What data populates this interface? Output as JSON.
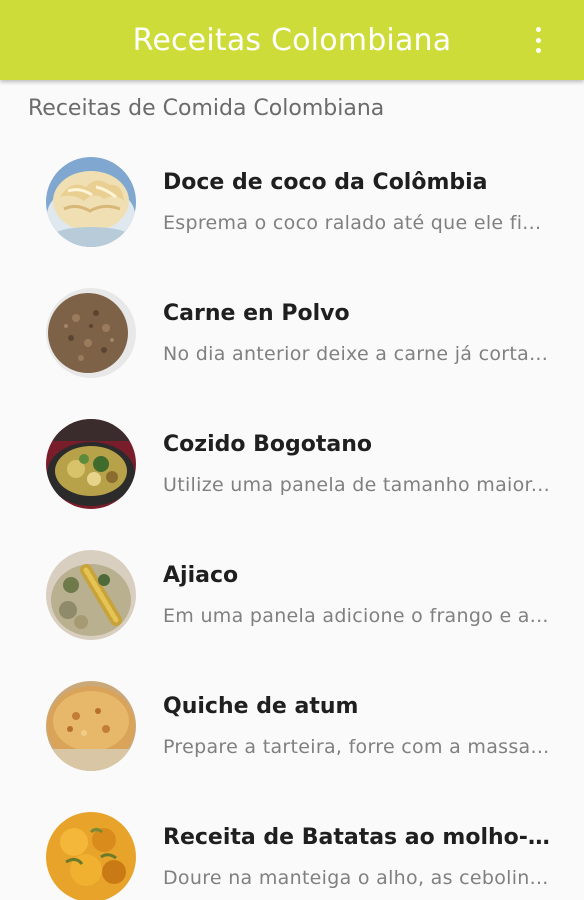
{
  "appbar": {
    "title": "Receitas Colombiana",
    "color": "#cddc39",
    "menu_icon": "overflow-menu-icon"
  },
  "section": {
    "header": "Receitas de Comida Colombiana"
  },
  "recipes": [
    {
      "title": "Doce de coco da Colômbia",
      "subtitle": "Esprema o coco ralado até que ele fi...",
      "image": "coconut-dessert-photo"
    },
    {
      "title": "Carne en Polvo",
      "subtitle": "No dia anterior deixe a carne já corta...",
      "image": "ground-meat-photo"
    },
    {
      "title": "Cozido Bogotano",
      "subtitle": "Utilize uma panela de tamanho maior...",
      "image": "stew-photo"
    },
    {
      "title": "Ajiaco",
      "subtitle": "Em uma panela adicione o frango e a...",
      "image": "ajiaco-soup-photo"
    },
    {
      "title": "Quiche de atum",
      "subtitle": "Prepare a tarteira, forre com a massa...",
      "image": "tuna-quiche-photo"
    },
    {
      "title": "Receita de Batatas ao molho-pa...",
      "subtitle": "Doure na manteiga o alho, as cebolin...",
      "image": "potatoes-sauce-photo"
    }
  ]
}
